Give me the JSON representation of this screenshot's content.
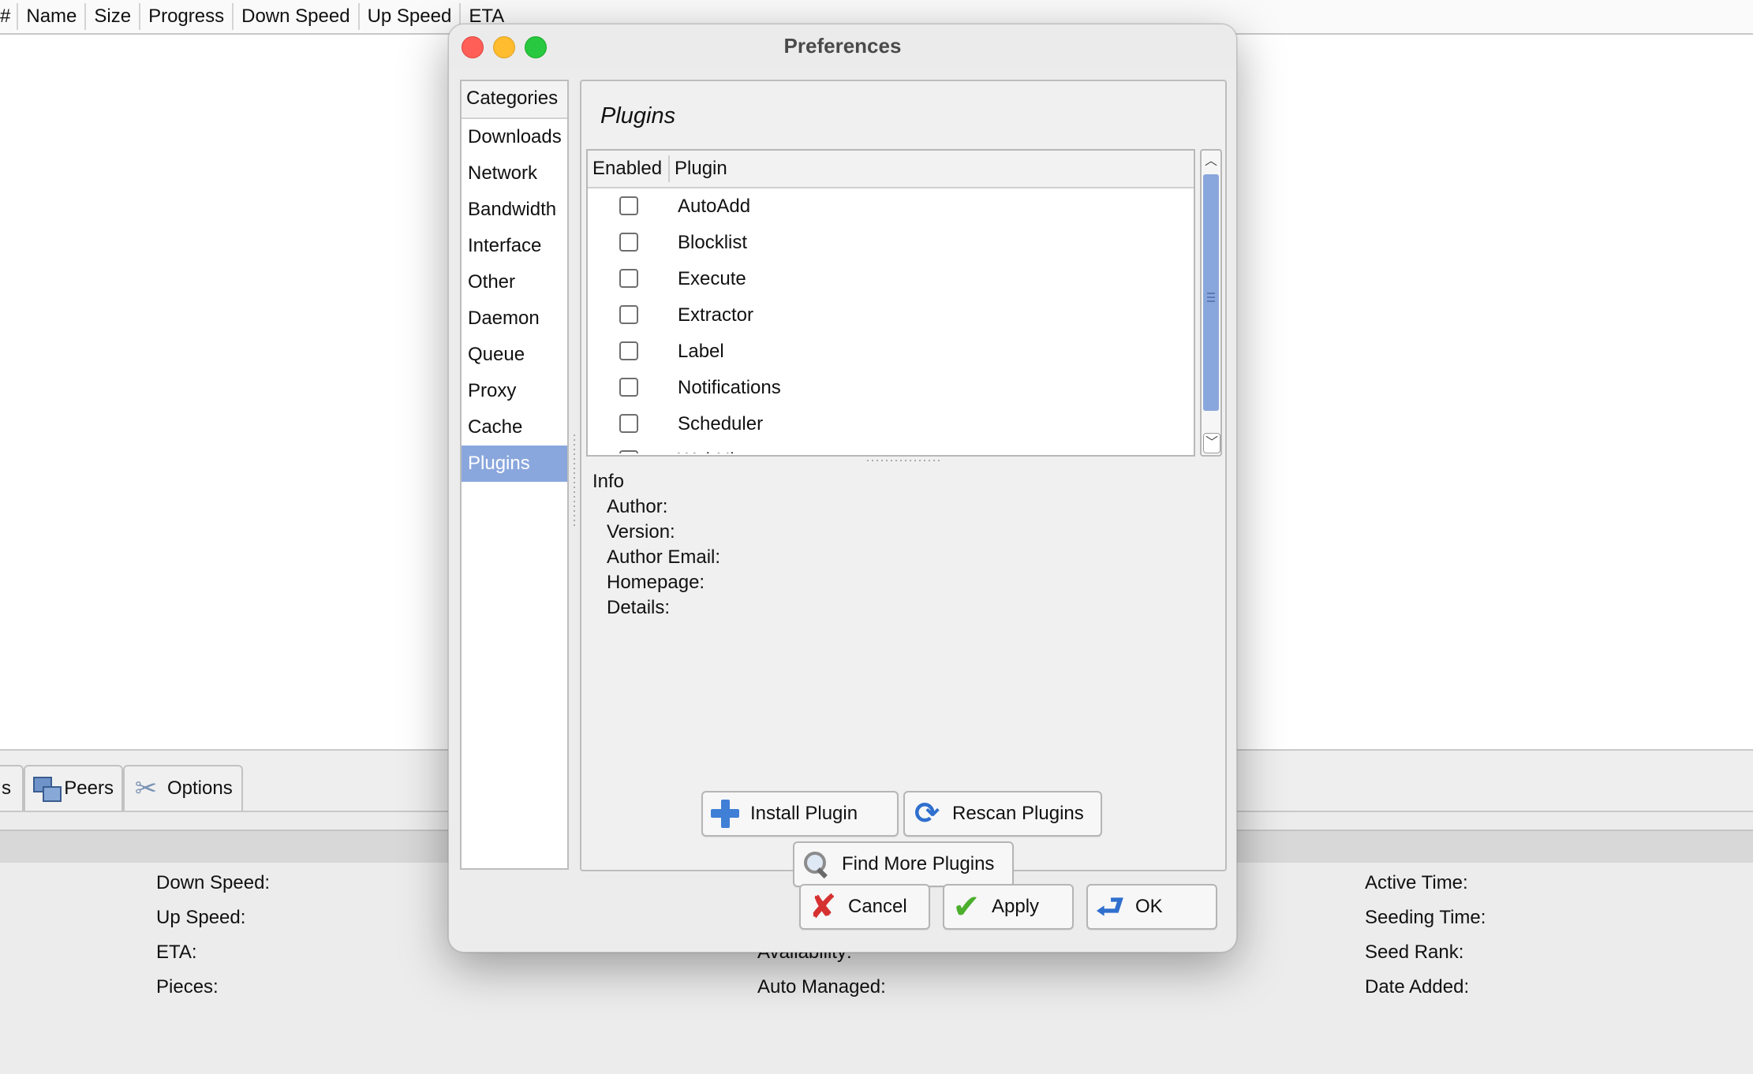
{
  "main": {
    "columns": [
      "#",
      "Name",
      "Size",
      "Progress",
      "Down Speed",
      "Up Speed",
      "ETA"
    ],
    "tabs": [
      {
        "label": "s",
        "icon": "files-icon"
      },
      {
        "label": "Peers",
        "icon": "peers-icon"
      },
      {
        "label": "Options",
        "icon": "options-icon"
      }
    ],
    "details": {
      "col1": [
        "Down Speed:",
        "Up Speed:",
        "ETA:",
        "Pieces:"
      ],
      "col2": [
        "Availability:",
        "Auto Managed:"
      ],
      "col3": [
        "Active Time:",
        "Seeding Time:",
        "Seed Rank:",
        "Date Added:"
      ]
    }
  },
  "dialog": {
    "title": "Preferences",
    "categories_header": "Categories",
    "categories": [
      "Downloads",
      "Network",
      "Bandwidth",
      "Interface",
      "Other",
      "Daemon",
      "Queue",
      "Proxy",
      "Cache",
      "Plugins"
    ],
    "selected_category": "Plugins",
    "panel_title": "Plugins",
    "table": {
      "col_enabled": "Enabled",
      "col_plugin": "Plugin",
      "plugins": [
        {
          "name": "AutoAdd",
          "enabled": false
        },
        {
          "name": "Blocklist",
          "enabled": false
        },
        {
          "name": "Execute",
          "enabled": false
        },
        {
          "name": "Extractor",
          "enabled": false
        },
        {
          "name": "Label",
          "enabled": false
        },
        {
          "name": "Notifications",
          "enabled": false
        },
        {
          "name": "Scheduler",
          "enabled": false
        },
        {
          "name": "WebUi",
          "enabled": false
        }
      ]
    },
    "info": {
      "title": "Info",
      "author": "Author:",
      "version": "Version:",
      "author_email": "Author Email:",
      "homepage": "Homepage:",
      "details": "Details:"
    },
    "buttons": {
      "install": "Install Plugin",
      "rescan": "Rescan Plugins",
      "find_more": "Find More Plugins",
      "cancel": "Cancel",
      "apply": "Apply",
      "ok": "OK"
    },
    "colors": {
      "selection": "#8aa7dd",
      "close": "#ff5f57",
      "minimize": "#febc2e",
      "maximize": "#28c840"
    }
  }
}
